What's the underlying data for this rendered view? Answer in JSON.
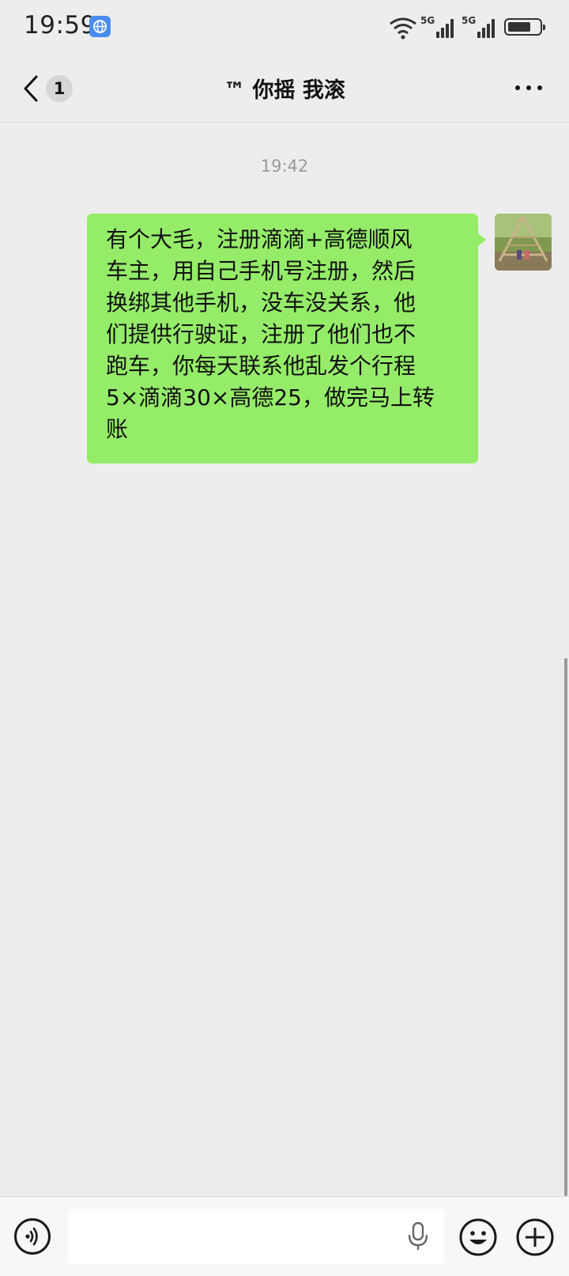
{
  "status_bar": {
    "time": "19:59",
    "network_1": "5G",
    "network_2": "5G",
    "icons": [
      "globe-icon",
      "wifi-icon",
      "signal-icon",
      "signal-icon",
      "battery-icon"
    ]
  },
  "header": {
    "unread_count": "1",
    "title": "™ 你摇 我滚",
    "icons": [
      "back-icon",
      "more-icon"
    ]
  },
  "chat": {
    "timestamp": "19:42",
    "messages": [
      {
        "sender": "self",
        "lines": [
          "有个大毛，注册滴滴+高德顺风",
          "车主，用自己手机号注册，然后",
          "换绑其他手机，没车没关系，他",
          "们提供行驶证，注册了他们也不",
          "跑车，你每天联系他乱发个行程",
          "5×滴滴30×高德25，做完马上转",
          "账"
        ]
      }
    ]
  },
  "input_bar": {
    "value": "",
    "icons": [
      "voice-icon",
      "mic-icon",
      "emoji-icon",
      "plus-icon"
    ]
  },
  "colors": {
    "background": "#ededed",
    "bubble_self": "#95ec69",
    "timestamp": "#9b9b9b"
  }
}
